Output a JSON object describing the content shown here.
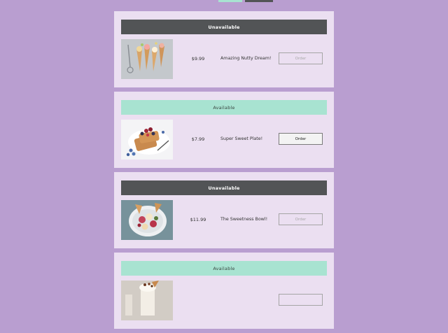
{
  "top_tabs": [
    {
      "name": "tab-available",
      "color": "#a8e3d1"
    },
    {
      "name": "tab-unavailable",
      "color": "#525456"
    }
  ],
  "colors": {
    "background": "#b99ed0",
    "card": "#ebdff1",
    "unavailable": "#525456",
    "available": "#a8e3d1"
  },
  "items": [
    {
      "status": "Unavailable",
      "price": "$9.99",
      "name": "Amazing Nutty Dream!",
      "order_label": "Order",
      "image": "ice-cream-cones-image"
    },
    {
      "status": "Available",
      "price": "$7.99",
      "name": "Super Sweet Plate!",
      "order_label": "Order",
      "image": "waffle-berries-image"
    },
    {
      "status": "Unavailable",
      "price": "$11.99",
      "name": "The Sweetness Bowl!",
      "order_label": "Order",
      "image": "dessert-bowl-image"
    },
    {
      "status": "Available",
      "price": "",
      "name": "",
      "order_label": "",
      "image": "sundae-glass-image"
    }
  ]
}
